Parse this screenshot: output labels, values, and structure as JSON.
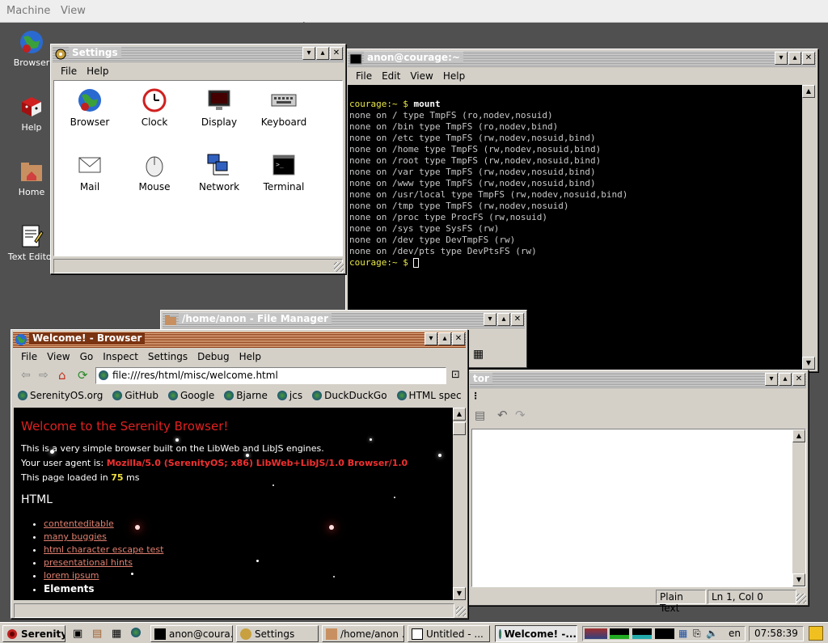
{
  "topbar": {
    "menu": [
      "Machine",
      "View"
    ]
  },
  "desktop_icons": [
    "Browser",
    "Help",
    "Home",
    "Text Editor"
  ],
  "settings": {
    "title": "Settings",
    "menu": [
      "File",
      "Help"
    ],
    "items": [
      "Browser",
      "Clock",
      "Display",
      "Keyboard",
      "Mail",
      "Mouse",
      "Network",
      "Terminal"
    ]
  },
  "terminal": {
    "title": "anon@courage:~",
    "menu": [
      "File",
      "Edit",
      "View",
      "Help"
    ],
    "prompt": "courage:~ $",
    "command": "mount",
    "lines": [
      "none on / type TmpFS (ro,nodev,nosuid)",
      "none on /bin type TmpFS (ro,nodev,bind)",
      "none on /etc type TmpFS (rw,nodev,nosuid,bind)",
      "none on /home type TmpFS (rw,nodev,nosuid,bind)",
      "none on /root type TmpFS (rw,nodev,nosuid,bind)",
      "none on /var type TmpFS (rw,nodev,nosuid,bind)",
      "none on /www type TmpFS (rw,nodev,nosuid,bind)",
      "none on /usr/local type TmpFS (rw,nodev,nosuid,bind)",
      "none on /tmp type TmpFS (rw,nodev,nosuid)",
      "none on /proc type ProcFS (rw,nosuid)",
      "none on /sys type SysFS (rw)",
      "none on /dev type DevTmpFS (rw)",
      "none on /dev/pts type DevPtsFS (rw)"
    ],
    "final_prompt": "courage:~ $"
  },
  "file_manager": {
    "title": "/home/anon - File Manager"
  },
  "text_editor": {
    "title_fragment": "tor",
    "status_mode": "Plain Text",
    "status_pos": "Ln 1, Col 0"
  },
  "browser": {
    "title": "Welcome! - Browser",
    "menu": [
      "File",
      "View",
      "Go",
      "Inspect",
      "Settings",
      "Debug",
      "Help"
    ],
    "url": "file:///res/html/misc/welcome.html",
    "bookmarks": [
      "SerenityOS.org",
      "GitHub",
      "Google",
      "Bjarne",
      "jcs",
      "DuckDuckGo",
      "HTML spec"
    ],
    "page": {
      "heading": "Welcome to the Serenity Browser!",
      "intro": "This is a very simple browser built on the LibWeb and LibJS engines.",
      "ua_label": "Your user agent is:",
      "ua_value": "Mozilla/5.0 (SerenityOS; x86) LibWeb+LibJS/1.0 Browser/1.0",
      "loaded_prefix": "This page loaded in",
      "loaded_ms": "75",
      "loaded_suffix": "ms",
      "html_heading": "HTML",
      "links": [
        "contenteditable",
        "many buggies",
        "html character escape test",
        "presentational hints",
        "lorem ipsum"
      ],
      "elements_heading": "Elements"
    }
  },
  "taskbar": {
    "start": "Serenity",
    "tasks": [
      "anon@coura...",
      "Settings",
      "/home/anon ...",
      "Untitled - ...",
      "Welcome! -..."
    ],
    "lang": "en",
    "clock": "07:58:39"
  }
}
